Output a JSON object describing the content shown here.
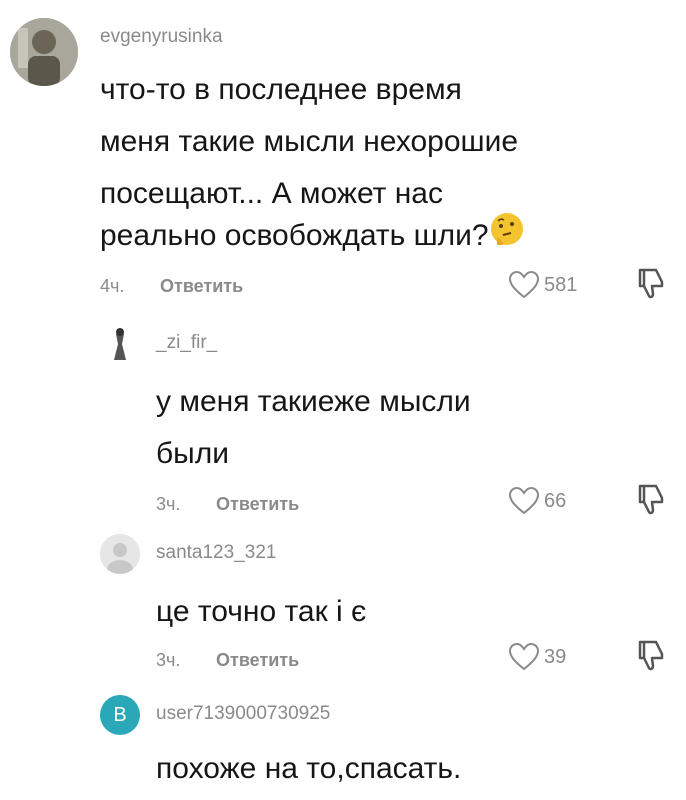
{
  "comments": [
    {
      "username": "evgenyrusinka",
      "text_lines": [
        "что-то в последнее время",
        "меня такие мысли нехорошие",
        "посещают... А может нас",
        "реально освобождать шли?"
      ],
      "emoji": "thinking-face",
      "time": "4ч.",
      "reply_label": "Ответить",
      "likes": "581"
    },
    {
      "username": "_zi_fir_",
      "text_lines": [
        "у меня такиеже мысли",
        "были"
      ],
      "time": "3ч.",
      "reply_label": "Ответить",
      "likes": "66"
    },
    {
      "username": "santa123_321",
      "text_lines": [
        "це точно так і є"
      ],
      "time": "3ч.",
      "reply_label": "Ответить",
      "likes": "39"
    },
    {
      "username": "user7139000730925",
      "avatar_letter": "B",
      "avatar_color": "#2aa8b8",
      "text_lines": [
        "похоже на то,спасать."
      ]
    }
  ],
  "icons": {
    "heart": "heart-icon",
    "dislike": "dislike-icon"
  }
}
